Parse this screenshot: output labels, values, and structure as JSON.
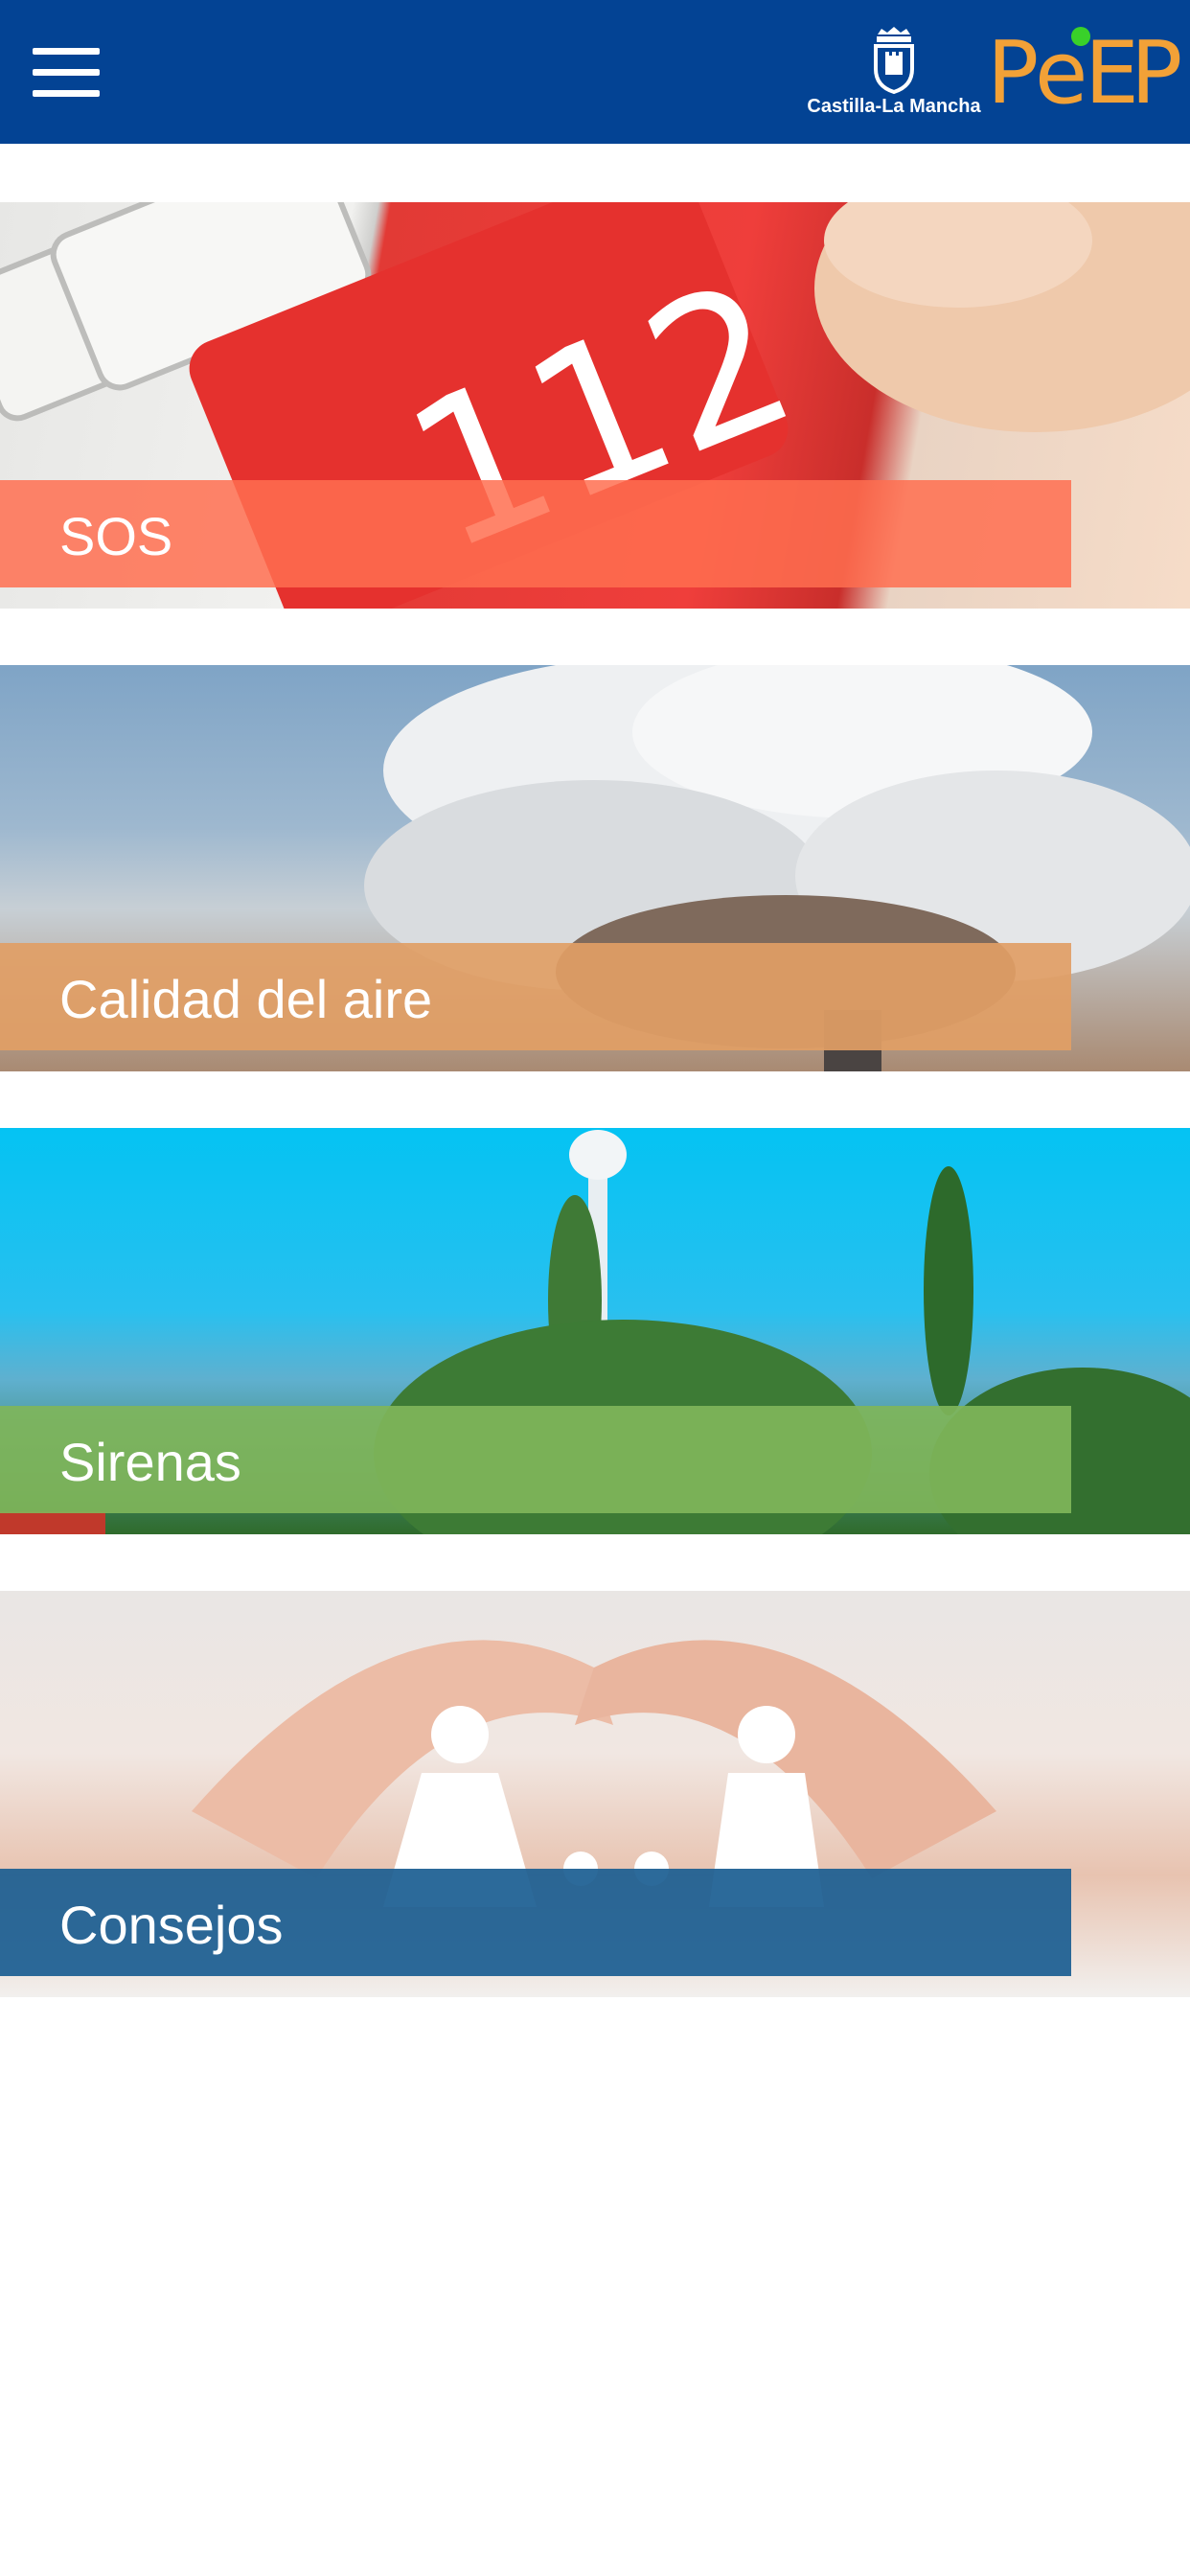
{
  "header": {
    "menu_icon": "hamburger-menu-icon",
    "gov_logo_text": "Castilla-La Mancha",
    "app_logo": {
      "letters": [
        "P",
        "e",
        "E",
        "P"
      ],
      "dot_color": "#39d12a",
      "color": "#f2a137"
    },
    "background_color": "#034394"
  },
  "cards": [
    {
      "label": "SOS",
      "image_text": "112",
      "bar_color": "#ff6e50"
    },
    {
      "label": "Calidad del aire",
      "bar_color": "#e19e65"
    },
    {
      "label": "Sirenas",
      "bar_color": "#7fb55a"
    },
    {
      "label": "Consejos",
      "bar_color": "#1a5d91"
    }
  ]
}
